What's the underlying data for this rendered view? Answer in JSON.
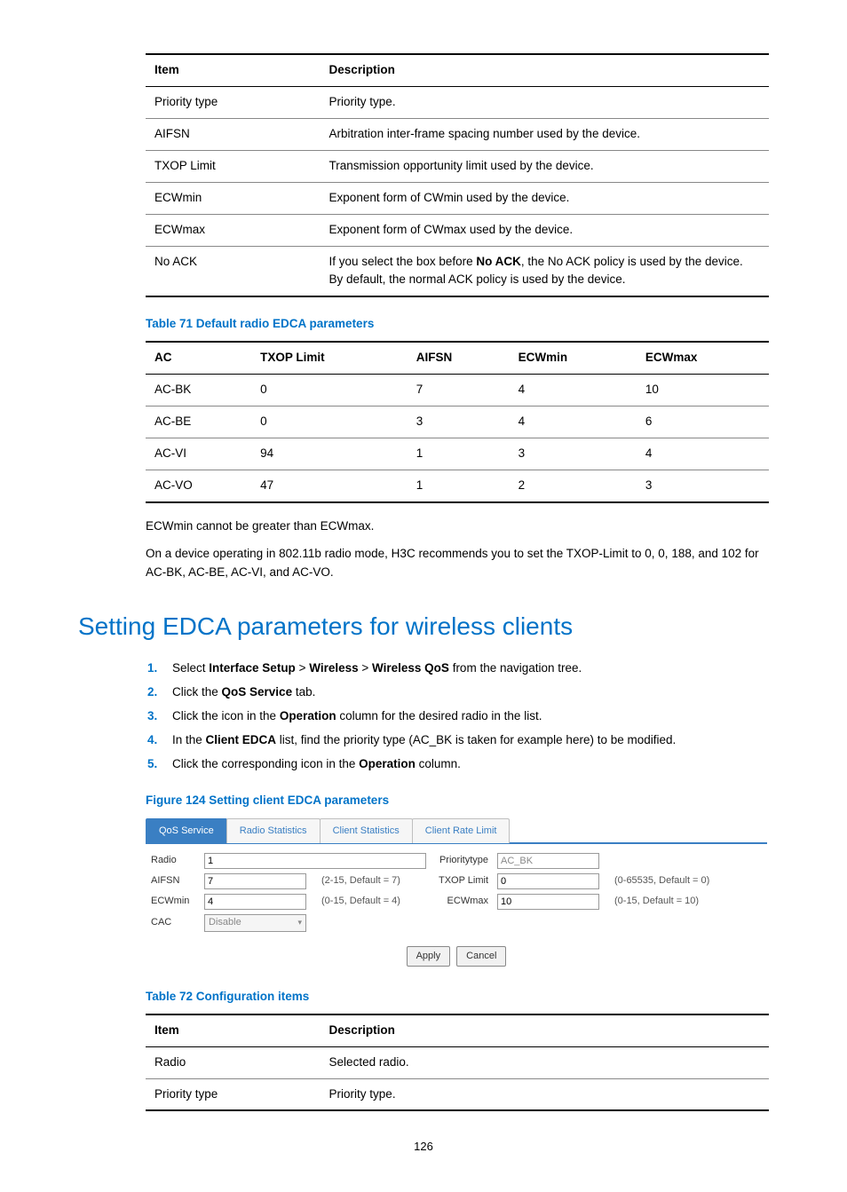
{
  "table70": {
    "hdr_item": "Item",
    "hdr_desc": "Description",
    "rows": [
      {
        "item": "Priority type",
        "desc": "Priority type."
      },
      {
        "item": "AIFSN",
        "desc": "Arbitration inter-frame spacing number used by the device."
      },
      {
        "item": "TXOP Limit",
        "desc": "Transmission opportunity limit used by the device."
      },
      {
        "item": "ECWmin",
        "desc": "Exponent form of CWmin used by the device."
      },
      {
        "item": "ECWmax",
        "desc": "Exponent form of CWmax used by the device."
      }
    ],
    "noack_item": "No ACK",
    "noack_pre": "If you select the box before ",
    "noack_bold": "No ACK",
    "noack_post": ", the No ACK policy is used by the device. By default, the normal ACK policy is used by the device."
  },
  "caption71": "Table 71 Default radio EDCA parameters",
  "chart_data": {
    "type": "table",
    "title": "Default radio EDCA parameters",
    "columns": [
      "AC",
      "TXOP Limit",
      "AIFSN",
      "ECWmin",
      "ECWmax"
    ],
    "rows": [
      {
        "AC": "AC-BK",
        "TXOP Limit": "0",
        "AIFSN": "7",
        "ECWmin": "4",
        "ECWmax": "10"
      },
      {
        "AC": "AC-BE",
        "TXOP Limit": "0",
        "AIFSN": "3",
        "ECWmin": "4",
        "ECWmax": "6"
      },
      {
        "AC": "AC-VI",
        "TXOP Limit": "94",
        "AIFSN": "1",
        "ECWmin": "3",
        "ECWmax": "4"
      },
      {
        "AC": "AC-VO",
        "TXOP Limit": "47",
        "AIFSN": "1",
        "ECWmin": "2",
        "ECWmax": "3"
      }
    ]
  },
  "note1": "ECWmin cannot be greater than ECWmax.",
  "note2": "On a device operating in 802.11b radio mode, H3C recommends you to set the TXOP-Limit to 0, 0, 188, and 102 for AC-BK, AC-BE, AC-VI, and AC-VO.",
  "section_h1": "Setting EDCA parameters for wireless clients",
  "steps": {
    "s1_a": "Select ",
    "s1_b": "Interface Setup",
    "s1_c": " > ",
    "s1_d": "Wireless",
    "s1_e": " > ",
    "s1_f": "Wireless QoS",
    "s1_g": " from the navigation tree.",
    "s2_a": "Click the ",
    "s2_b": "QoS Service",
    "s2_c": " tab.",
    "s3_a": "Click the icon in the ",
    "s3_b": "Operation",
    "s3_c": " column for the desired radio in the list.",
    "s4_a": "In the ",
    "s4_b": "Client EDCA",
    "s4_c": " list, find the priority type (AC_BK is taken for example here) to be modified.",
    "s5_a": "Click the corresponding icon in the ",
    "s5_b": "Operation",
    "s5_c": " column."
  },
  "figure124": "Figure 124 Setting client EDCA parameters",
  "ui": {
    "tabs": {
      "qos": "QoS Service",
      "rs": "Radio Statistics",
      "cs": "Client Statistics",
      "crl": "Client Rate Limit"
    },
    "labels": {
      "radio": "Radio",
      "ptype": "Prioritytype",
      "aifsn": "AIFSN",
      "txop": "TXOP Limit",
      "ecwmin": "ECWmin",
      "ecwmax": "ECWmax",
      "cac": "CAC"
    },
    "values": {
      "radio": "1",
      "ptype": "AC_BK",
      "aifsn": "7",
      "txop": "0",
      "ecwmin": "4",
      "ecwmax": "10",
      "cac": "Disable"
    },
    "hints": {
      "aifsn": "(2-15, Default = 7)",
      "txop": "(0-65535, Default = 0)",
      "ecwmin": "(0-15, Default = 4)",
      "ecwmax": "(0-15, Default = 10)"
    },
    "buttons": {
      "apply": "Apply",
      "cancel": "Cancel"
    }
  },
  "caption72": "Table 72 Configuration items",
  "table72": {
    "hdr_item": "Item",
    "hdr_desc": "Description",
    "rows": [
      {
        "item": "Radio",
        "desc": "Selected radio."
      },
      {
        "item": "Priority type",
        "desc": "Priority type."
      }
    ]
  },
  "page_num": "126"
}
